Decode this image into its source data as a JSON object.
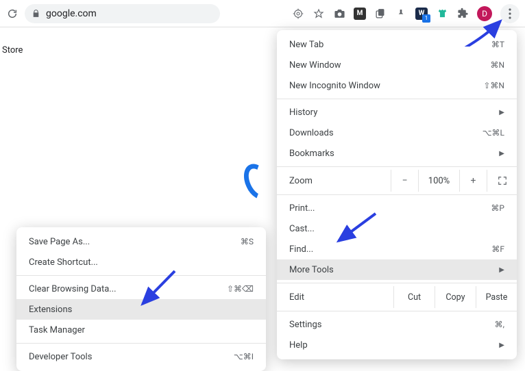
{
  "toolbar": {
    "url": "google.com",
    "avatar_initial": "D",
    "badge_value": "1"
  },
  "page": {
    "store_label": "Store"
  },
  "main_menu": {
    "new_tab": "New Tab",
    "new_tab_sc": "⌘T",
    "new_window": "New Window",
    "new_window_sc": "⌘N",
    "new_incognito": "New Incognito Window",
    "new_incognito_sc": "⇧⌘N",
    "history": "History",
    "downloads": "Downloads",
    "downloads_sc": "⌥⌘L",
    "bookmarks": "Bookmarks",
    "zoom_label": "Zoom",
    "zoom_minus": "−",
    "zoom_value": "100%",
    "zoom_plus": "+",
    "print": "Print...",
    "print_sc": "⌘P",
    "cast": "Cast...",
    "find": "Find...",
    "find_sc": "⌘F",
    "more_tools": "More Tools",
    "edit_label": "Edit",
    "cut": "Cut",
    "copy": "Copy",
    "paste": "Paste",
    "settings": "Settings",
    "settings_sc": "⌘,",
    "help": "Help"
  },
  "sub_menu": {
    "save_page": "Save Page As...",
    "save_page_sc": "⌘S",
    "create_shortcut": "Create Shortcut...",
    "clear_data": "Clear Browsing Data...",
    "clear_data_sc": "⇧⌘⌫",
    "extensions": "Extensions",
    "task_manager": "Task Manager",
    "dev_tools": "Developer Tools",
    "dev_tools_sc": "⌥⌘I"
  }
}
